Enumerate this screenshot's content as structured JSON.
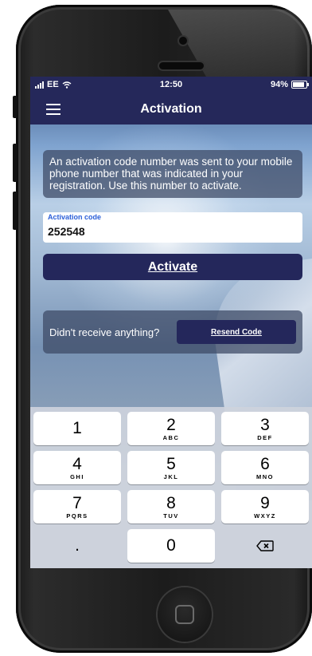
{
  "status_bar": {
    "carrier": "EE",
    "time": "12:50",
    "battery": "94%"
  },
  "app_bar": {
    "title": "Activation",
    "menu_icon": "hamburger-menu-icon"
  },
  "activation": {
    "message": "An activation code number was sent to your mobile phone number that was indicated in your registration. Use this number to activate.",
    "code_label": "Activation code",
    "code_value": "252548",
    "activate_label": "Activate"
  },
  "resend": {
    "prompt": "Didn't receive anything?",
    "button_label": "Resend Code"
  },
  "keypad": {
    "keys": [
      {
        "num": "1",
        "letters": ""
      },
      {
        "num": "2",
        "letters": "ABC"
      },
      {
        "num": "3",
        "letters": "DEF"
      },
      {
        "num": "4",
        "letters": "GHI"
      },
      {
        "num": "5",
        "letters": "JKL"
      },
      {
        "num": "6",
        "letters": "MNO"
      },
      {
        "num": "7",
        "letters": "PQRS"
      },
      {
        "num": "8",
        "letters": "TUV"
      },
      {
        "num": "9",
        "letters": "WXYZ"
      },
      {
        "num": ".",
        "letters": ""
      },
      {
        "num": "0",
        "letters": ""
      }
    ],
    "backspace_icon": "backspace-icon"
  },
  "colors": {
    "navy": "#25285a",
    "label_blue": "#2b5fd8"
  }
}
